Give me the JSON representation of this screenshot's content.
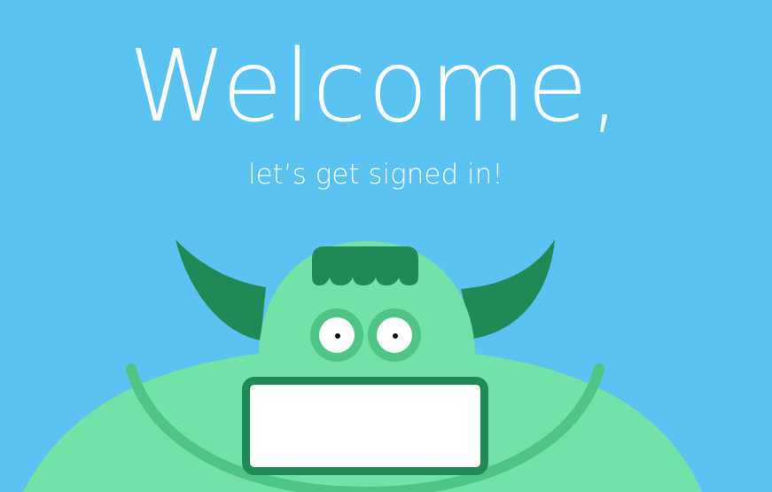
{
  "header": {
    "title": "Welcome,",
    "subtitle": "let’s get signed in!"
  },
  "login": {
    "field_value": "",
    "field_placeholder": ""
  },
  "colors": {
    "background": "#5ac3f1",
    "monster_body": "#72e2a8",
    "monster_dark": "#1f8a56",
    "monster_shade": "#4ec584",
    "text": "#ffffff"
  }
}
